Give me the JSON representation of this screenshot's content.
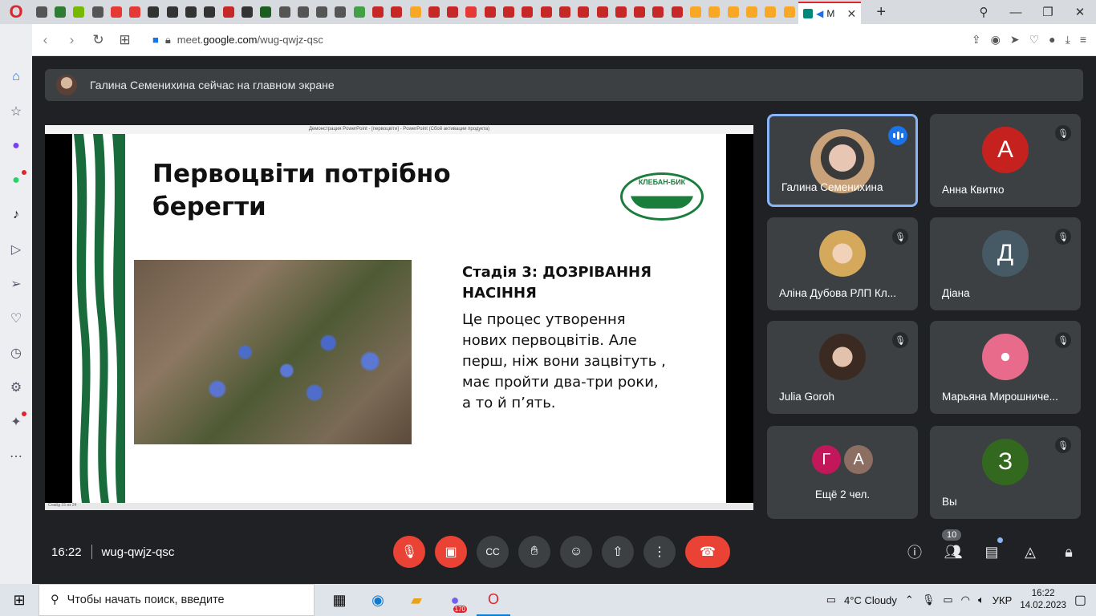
{
  "browser": {
    "active_tab_title": "M",
    "url_prefix": "meet.",
    "url_host": "google.com",
    "url_path": "/wug-qwjz-qsc",
    "tab_colors": [
      "#555",
      "#2f7d32",
      "#76b900",
      "#555",
      "#e53935",
      "#e53935",
      "#333",
      "#333",
      "#333",
      "#333",
      "#c62828",
      "#333",
      "#1b5e20",
      "#555",
      "#555",
      "#555",
      "#555",
      "#43a047",
      "#c62828",
      "#c62828",
      "#f9a825",
      "#c62828",
      "#c62828",
      "#e53935",
      "#c62828",
      "#c62828",
      "#c62828",
      "#c62828",
      "#c62828",
      "#c62828",
      "#c62828",
      "#c62828",
      "#c62828",
      "#c62828",
      "#c62828",
      "#f9a825",
      "#f9a825",
      "#f9a825",
      "#f9a825",
      "#f9a825",
      "#f9a825"
    ]
  },
  "meet": {
    "banner_text": "Галина Семенихина сейчас на главном экране",
    "presentation_window_title": "Демонстрация PowerPoint - [первоцвіти] - PowerPoint (Сбой активации продукта)",
    "presentation_status": "Слайд 15 из 24",
    "slide": {
      "title_line1": "Первоцвіти потрібно",
      "title_line2": "берегти",
      "logo_text": "КЛЕБАН-БИК",
      "heading_line1": "Стадія 3: ДОЗРІВАННЯ",
      "heading_line2": "НАСІННЯ",
      "body_lines": [
        "Це процес утворення",
        "нових первоцвітів. Але",
        "перш, ніж вони зацвітуть ,",
        "має пройти два-три роки,",
        "а то й п’ять."
      ]
    },
    "participants": [
      {
        "name": "Галина Семенихина",
        "speaking": true
      },
      {
        "name": "Анна Квитко",
        "initial": "А",
        "color": "#c5221f"
      },
      {
        "name": "Аліна Дубова РЛП Кл..."
      },
      {
        "name": "Діана",
        "initial": "Д",
        "color": "#455a64"
      },
      {
        "name": "Julia Goroh"
      },
      {
        "name": "Марьяна Мирошниче..."
      },
      {
        "more_label": "Ещё 2 чел.",
        "mini1": "Г",
        "mini2": "А"
      },
      {
        "name": "Вы",
        "initial": "З",
        "color": "#33691e"
      }
    ],
    "time": "16:22",
    "meeting_code": "wug-qwjz-qsc",
    "people_count": "10"
  },
  "taskbar": {
    "search_placeholder": "Чтобы начать поиск, введите",
    "viber_badge": "170",
    "weather": "4°C  Cloudy",
    "lang": "УКР",
    "time": "16:22",
    "date": "14.02.2023"
  }
}
